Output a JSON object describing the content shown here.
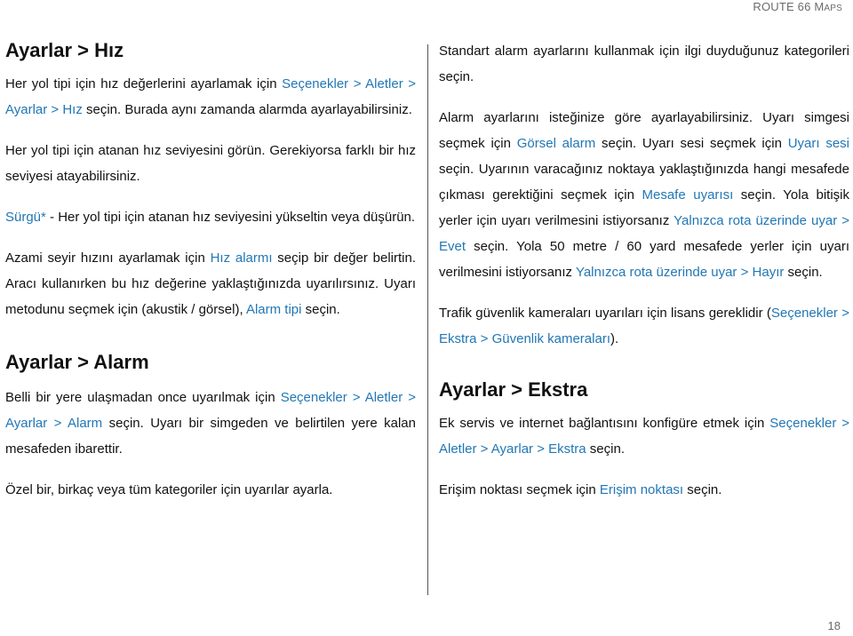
{
  "header": {
    "title_main": "ROUTE 66 M",
    "title_small": "APS"
  },
  "page_number": "18",
  "left": {
    "speed": {
      "heading": "Ayarlar > Hız",
      "p1": {
        "t1": "Her yol tipi için hız değerlerini ayarlamak için ",
        "link": "Seçenekler > Aletler > Ayarlar > Hız",
        "t2": " seçin. Burada aynı zamanda alarmda ayarlayabilirsiniz."
      },
      "p2": "Her yol tipi için atanan hız seviyesini görün. Gerekiyorsa farklı bir hız seviyesi atayabilirsiniz.",
      "p3": {
        "link": "Sürgü*",
        "t1": " - Her yol tipi için atanan hız seviyesini yükseltin veya düşürün."
      },
      "p4": {
        "t1": "Azami seyir hızını ayarlamak için ",
        "link1": "Hız alarmı",
        "t2": " seçip bir değer belirtin. Aracı kullanırken bu hız değerine yaklaştığınızda uyarılırsınız. Uyarı metodunu seçmek için (akustik / görsel), ",
        "link2": "Alarm tipi",
        "t3": " seçin."
      }
    },
    "alarm": {
      "heading": "Ayarlar > Alarm",
      "p1": {
        "t1": "Belli bir yere ulaşmadan once uyarılmak için ",
        "link": "Seçenekler > Aletler > Ayarlar > Alarm",
        "t2": " seçin. Uyarı bir simgeden ve belirtilen yere kalan mesafeden ibarettir."
      },
      "p2": "Özel bir, birkaç veya tüm kategoriler için uyarılar ayarla."
    }
  },
  "right": {
    "alarm_cont": {
      "p1": "Standart alarm ayarlarını kullanmak için ilgi duyduğunuz kategorileri seçin.",
      "p2": {
        "t1": "Alarm ayarlarını isteğinize göre ayarlayabilirsiniz. Uyarı simgesi seçmek için ",
        "link1": "Görsel alarm",
        "t2": " seçin. Uyarı sesi seçmek için ",
        "link2": "Uyarı sesi",
        "t3": " seçin. Uyarının varacağınız noktaya yaklaştığınızda hangi mesafede çıkması gerektiğini seçmek için ",
        "link3": "Mesafe uyarısı",
        "t4": " seçin. Yola bitişik yerler için uyarı verilmesini istiyorsanız ",
        "link4": "Yalnızca rota üzerinde uyar > Evet",
        "t5": " seçin. Yola 50 metre / 60 yard mesafede yerler için uyarı verilmesini istiyorsanız ",
        "link5": "Yalnızca rota üzerinde uyar > Hayır",
        "t6": " seçin."
      },
      "p3": {
        "t1": "Trafik güvenlik kameraları uyarıları için lisans gereklidir (",
        "link": "Seçenekler > Ekstra > Güvenlik kameraları",
        "t2": ")."
      }
    },
    "extra": {
      "heading": "Ayarlar > Ekstra",
      "p1": {
        "t1": "Ek servis ve internet bağlantısını konfigüre etmek için ",
        "link": "Seçenekler > Aletler > Ayarlar > Ekstra",
        "t2": " seçin."
      },
      "p2": {
        "t1": "Erişim noktası seçmek için ",
        "link": "Erişim noktası",
        "t2": " seçin."
      }
    }
  },
  "colors": {
    "link": "#2277b5",
    "text": "#111111",
    "header": "#6b6b6b"
  }
}
